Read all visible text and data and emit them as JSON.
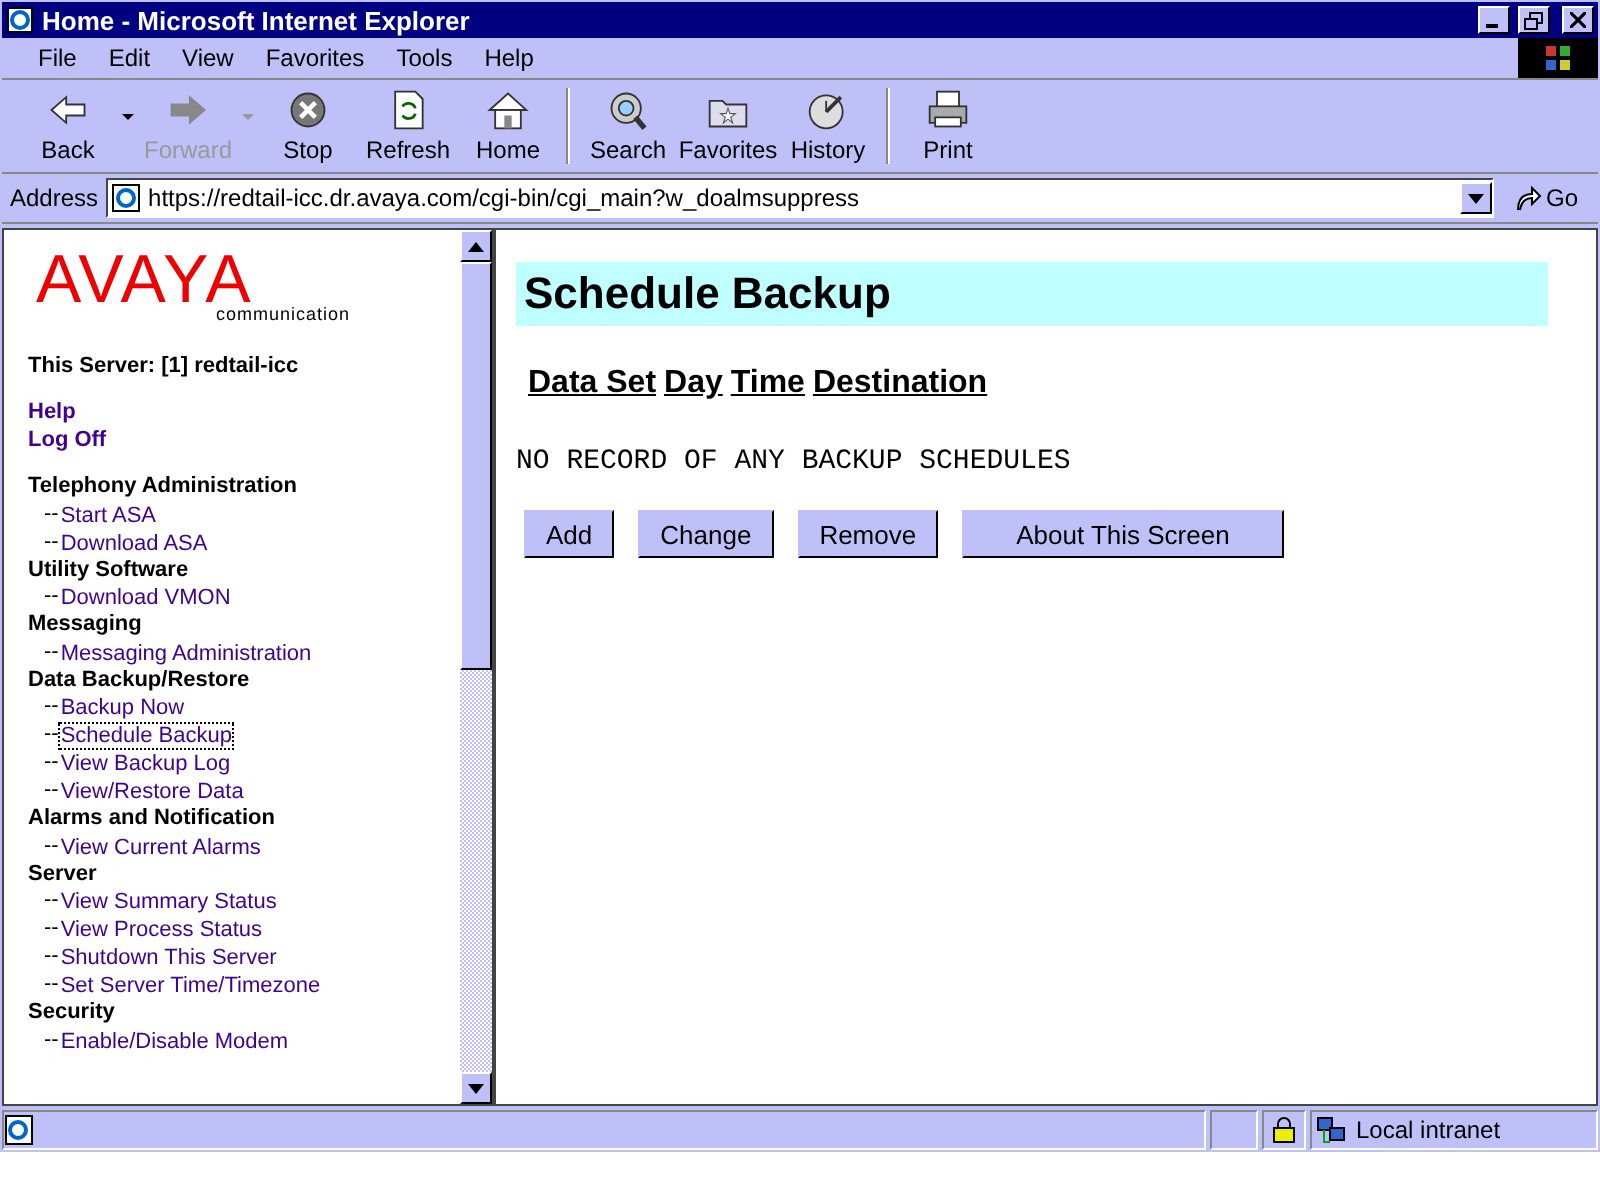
{
  "window": {
    "title": "Home - Microsoft Internet Explorer"
  },
  "menu": [
    "File",
    "Edit",
    "View",
    "Favorites",
    "Tools",
    "Help"
  ],
  "toolbar": [
    {
      "label": "Back",
      "kind": "back",
      "disabled": false,
      "dropdown": true
    },
    {
      "label": "Forward",
      "kind": "forward",
      "disabled": true,
      "dropdown": true
    },
    {
      "label": "Stop",
      "kind": "stop",
      "disabled": false,
      "dropdown": false
    },
    {
      "label": "Refresh",
      "kind": "refresh",
      "disabled": false,
      "dropdown": false
    },
    {
      "label": "Home",
      "kind": "home",
      "disabled": false,
      "dropdown": false
    },
    {
      "label": "Search",
      "kind": "search",
      "disabled": false,
      "dropdown": false
    },
    {
      "label": "Favorites",
      "kind": "favorites",
      "disabled": false,
      "dropdown": false
    },
    {
      "label": "History",
      "kind": "history",
      "disabled": false,
      "dropdown": false
    },
    {
      "label": "Print",
      "kind": "print",
      "disabled": false,
      "dropdown": false
    }
  ],
  "address": {
    "label": "Address",
    "value": "https://redtail-icc.dr.avaya.com/cgi-bin/cgi_main?w_doalmsuppress",
    "go": "Go"
  },
  "sidebar": {
    "logo": {
      "name": "AVAYA",
      "tagline": "communication"
    },
    "server": "This Server: [1] redtail-icc",
    "top_links": [
      "Help",
      "Log Off"
    ],
    "link_prefix": "--",
    "sections": [
      {
        "title": "Telephony Administration",
        "links": [
          {
            "label": "Start ASA",
            "selected": false
          },
          {
            "label": "Download ASA",
            "selected": false
          }
        ]
      },
      {
        "title": "Utility Software",
        "links": [
          {
            "label": "Download VMON",
            "selected": false
          }
        ]
      },
      {
        "title": "Messaging",
        "links": [
          {
            "label": "Messaging Administration",
            "selected": false
          }
        ]
      },
      {
        "title": "Data Backup/Restore",
        "links": [
          {
            "label": "Backup Now",
            "selected": false
          },
          {
            "label": "Schedule Backup",
            "selected": true
          },
          {
            "label": "View Backup Log",
            "selected": false
          },
          {
            "label": "View/Restore Data",
            "selected": false
          }
        ]
      },
      {
        "title": "Alarms and Notification",
        "links": [
          {
            "label": "View Current Alarms",
            "selected": false
          }
        ]
      },
      {
        "title": "Server",
        "links": [
          {
            "label": "View Summary Status",
            "selected": false
          },
          {
            "label": "View Process Status",
            "selected": false
          },
          {
            "label": "Shutdown This Server",
            "selected": false
          },
          {
            "label": "Set Server Time/Timezone",
            "selected": false
          }
        ]
      },
      {
        "title": "Security",
        "links": [
          {
            "label": "Enable/Disable Modem",
            "selected": false
          }
        ]
      }
    ]
  },
  "main": {
    "title": "Schedule Backup",
    "columns": [
      "Data Set",
      "Day",
      "Time",
      "Destination"
    ],
    "message": "NO RECORD OF ANY BACKUP SCHEDULES",
    "buttons": [
      "Add",
      "Change",
      "Remove",
      "About This Screen"
    ]
  },
  "status_bar": {
    "zone": "Local intranet"
  }
}
